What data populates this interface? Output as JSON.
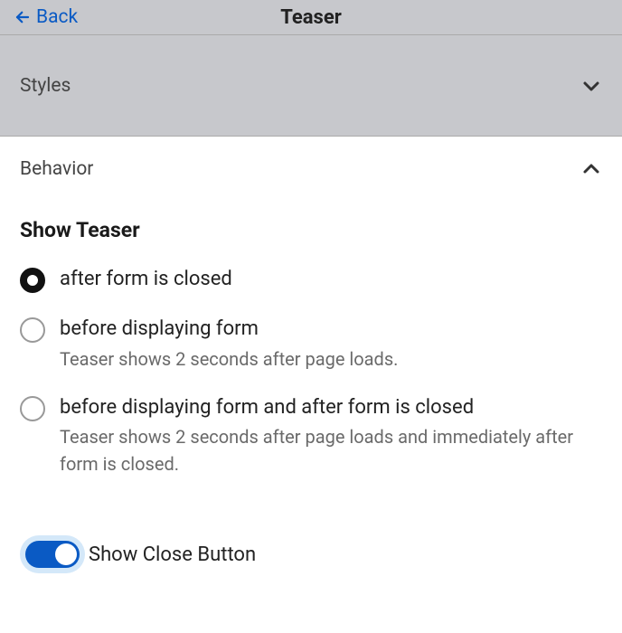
{
  "header": {
    "back_label": "Back",
    "title": "Teaser"
  },
  "sections": {
    "styles": {
      "title": "Styles"
    },
    "behavior": {
      "title": "Behavior"
    }
  },
  "show_teaser": {
    "group_title": "Show Teaser",
    "options": [
      {
        "label": "after form is closed",
        "sub": ""
      },
      {
        "label": "before displaying form",
        "sub": "Teaser shows 2 seconds after page loads."
      },
      {
        "label": "before displaying form and after form is closed",
        "sub": "Teaser shows 2 seconds after page loads and immediately after form is closed."
      }
    ],
    "selected_index": 0
  },
  "close_button": {
    "label": "Show Close Button",
    "enabled": true
  }
}
